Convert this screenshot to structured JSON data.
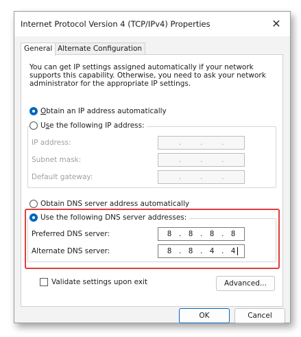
{
  "window": {
    "title": "Internet Protocol Version 4 (TCP/IPv4) Properties",
    "close_glyph": "✕"
  },
  "tabs": [
    {
      "label": "General",
      "active": true
    },
    {
      "label": "Alternate Configuration",
      "active": false
    }
  ],
  "info_text": "You can get IP settings assigned automatically if your network supports this capability. Otherwise, you need to ask your network administrator for the appropriate IP settings.",
  "ip_mode": {
    "auto_label_key": "O",
    "auto_label_rest": "btain an IP address automatically",
    "auto_selected": true,
    "manual_label_pre": "U",
    "manual_label_key": "s",
    "manual_label_rest": "e the following IP address:",
    "manual_selected": false
  },
  "ip_fields": {
    "ip_address_label": "IP address:",
    "subnet_label": "Subnet mask:",
    "gateway_label": "Default gateway:",
    "dot": "."
  },
  "dns_mode": {
    "auto_label": "Obtain DNS server address automatically",
    "auto_selected": false,
    "manual_label": "Use the following DNS server addresses:",
    "manual_selected": true
  },
  "dns_fields": {
    "preferred_label": "Preferred DNS server:",
    "preferred_octets": [
      "8",
      "8",
      "8",
      "8"
    ],
    "alternate_label": "Alternate DNS server:",
    "alternate_octets": [
      "8",
      "8",
      "4",
      "4"
    ]
  },
  "validate": {
    "label": "Validate settings upon exit",
    "checked": false
  },
  "buttons": {
    "advanced": "Advanced...",
    "ok": "OK",
    "cancel": "Cancel"
  },
  "colors": {
    "accent": "#0067c0",
    "highlight": "#e03c3c"
  },
  "icons": [
    "close-icon"
  ]
}
